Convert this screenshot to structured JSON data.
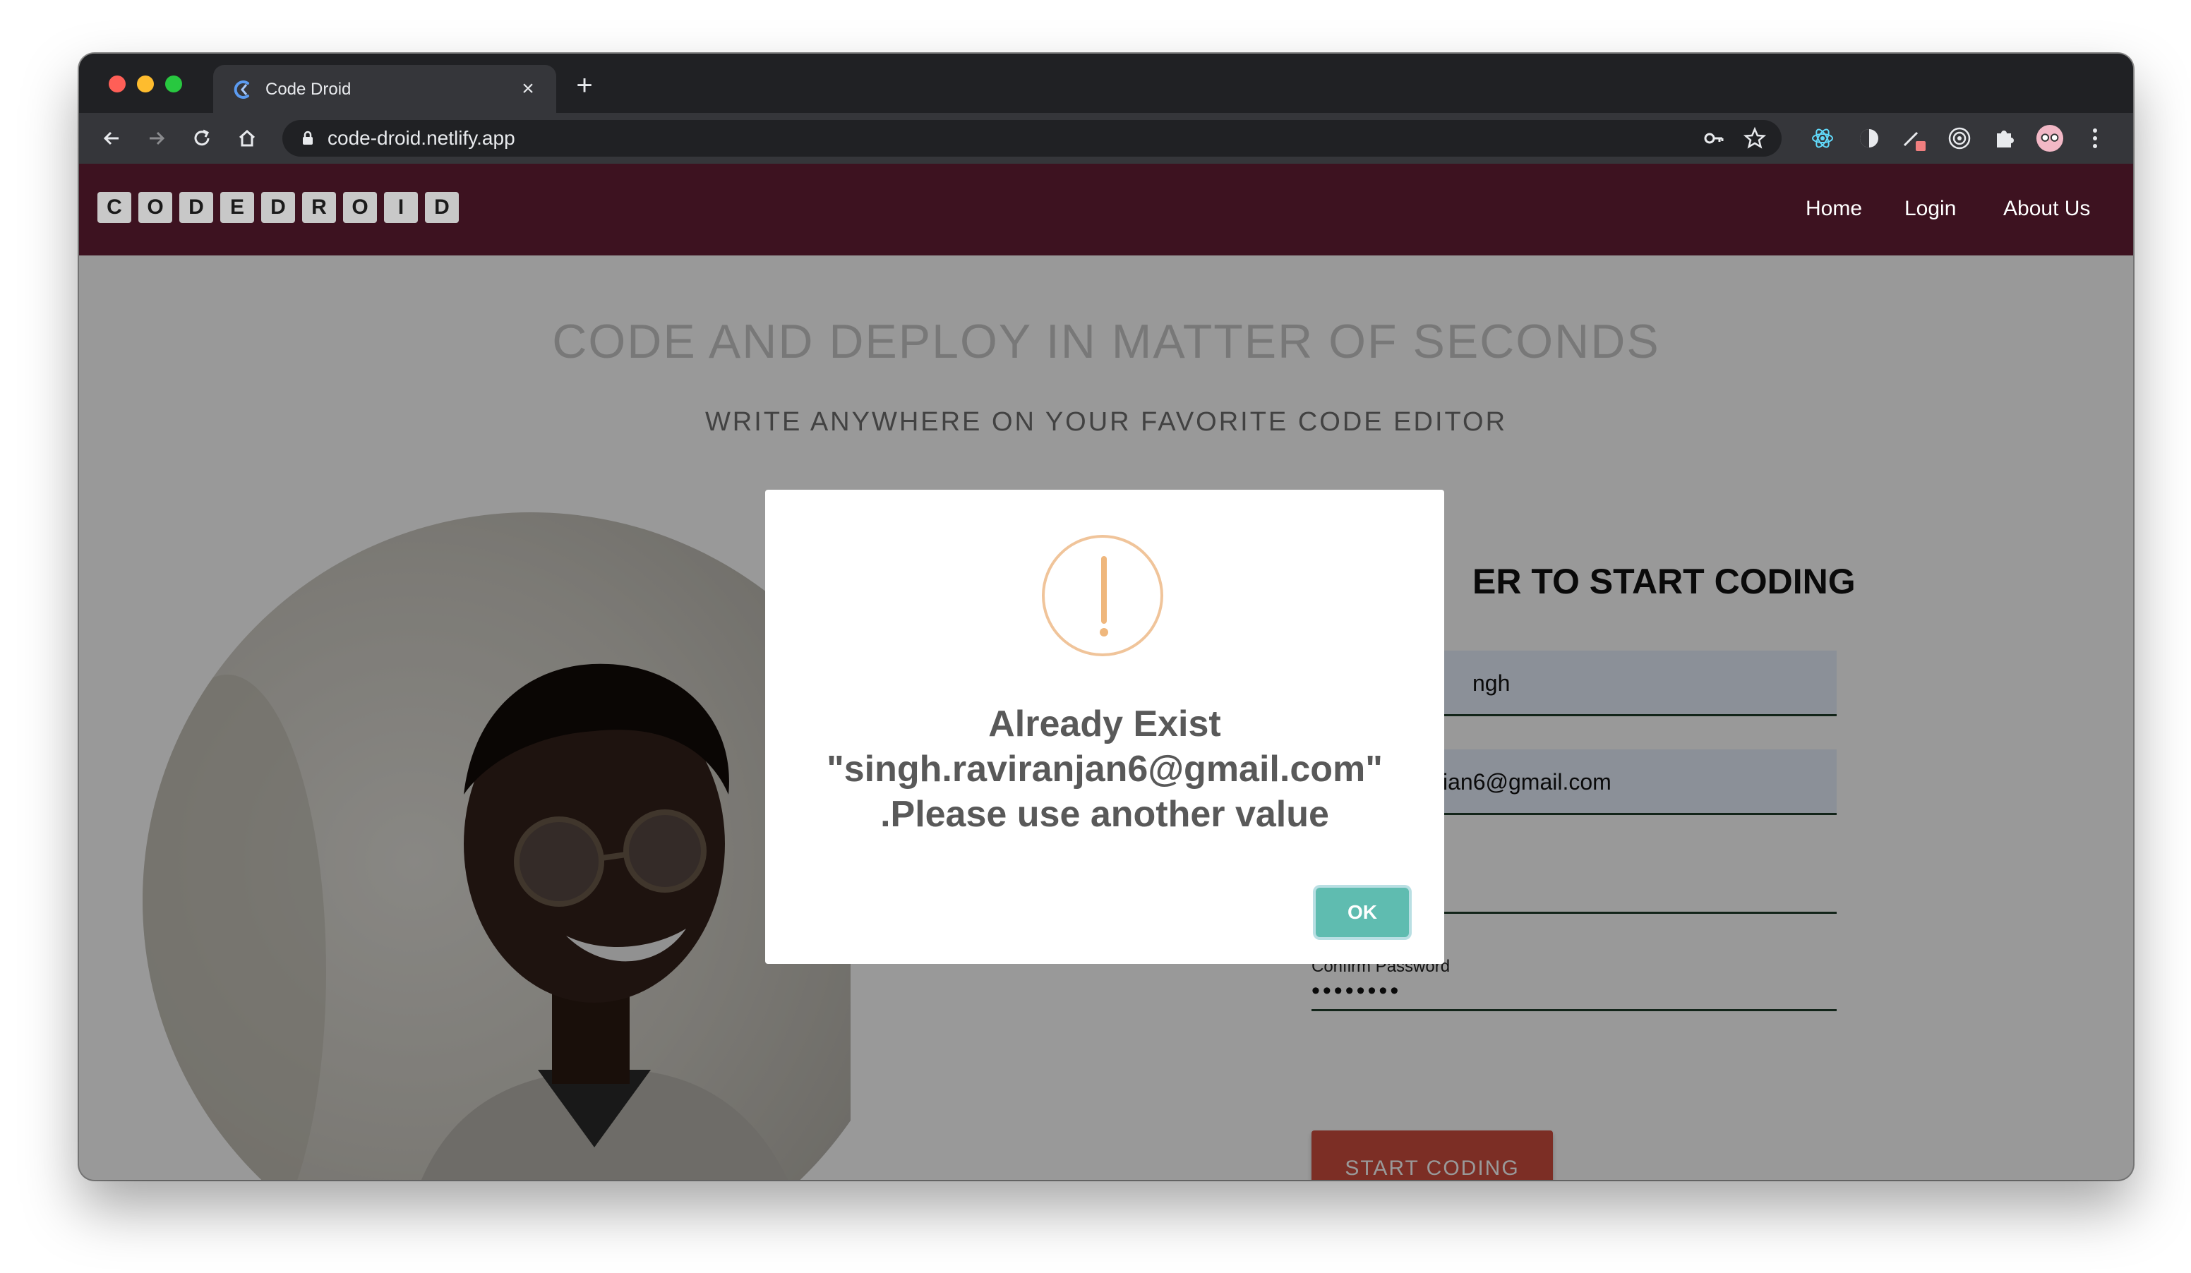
{
  "browser": {
    "tab_title": "Code Droid",
    "tab_icon": "code-droid-favicon",
    "url": "code-droid.netlify.app",
    "colors": {
      "frame": "#202124",
      "toolbar": "#35363a"
    }
  },
  "site": {
    "logo_letters": [
      "C",
      "O",
      "D",
      "E",
      "D",
      "R",
      "O",
      "I",
      "D"
    ],
    "nav": {
      "home": "Home",
      "login": "Login",
      "about": "About Us"
    },
    "navbar_color": "#3d1220"
  },
  "hero": {
    "title": "CODE AND DEPLOY IN MATTER OF SECONDS",
    "subtitle": "WRITE ANYWHERE ON YOUR FAVORITE CODE EDITOR"
  },
  "form": {
    "heading": "ER TO START CODING",
    "name_value": "ngh",
    "email_value": "ian6@gmail.com",
    "confirm_password_label": "Confirm Password",
    "confirm_password_value": "••••••••",
    "submit_label": "START CODING",
    "submit_color": "#cf4d3f"
  },
  "modal": {
    "icon": "warning-icon",
    "line1": "Already Exist",
    "line2": "\"singh.raviranjan6@gmail.com\"",
    "line3": ".Please use another value",
    "ok_label": "OK",
    "ok_color": "#5fbcb0"
  }
}
